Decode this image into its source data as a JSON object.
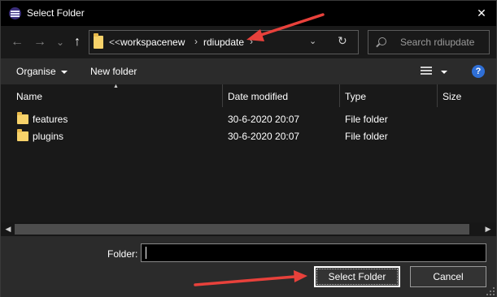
{
  "window": {
    "title": "Select Folder",
    "close_glyph": "✕"
  },
  "nav": {
    "back_icon": "←",
    "forward_icon": "→",
    "history_icon": "⌄",
    "up_icon": "↑",
    "breadcrumb_overflow": "<<",
    "breadcrumbs": [
      "workspacenew",
      "rdiupdate"
    ],
    "breadcrumb_sep": "›",
    "refresh_icon": "↻",
    "search_placeholder": "Search rdiupdate"
  },
  "toolbar": {
    "organise_label": "Organise",
    "new_folder_label": "New folder",
    "help_label": "?"
  },
  "columns": [
    "Name",
    "Date modified",
    "Type",
    "Size"
  ],
  "files": [
    {
      "name": "features",
      "date": "30-6-2020 20:07",
      "type": "File folder",
      "size": ""
    },
    {
      "name": "plugins",
      "date": "30-6-2020 20:07",
      "type": "File folder",
      "size": ""
    }
  ],
  "scrollbar": {
    "left_arrow": "◀",
    "right_arrow": "▶"
  },
  "bottom": {
    "folder_label": "Folder:",
    "folder_value": "",
    "select_button": "Select Folder",
    "cancel_button": "Cancel"
  },
  "colors": {
    "annotation_arrow": "#e8413b",
    "help_blue": "#2f6fd6",
    "folder_yellow": "#f7d26a"
  }
}
